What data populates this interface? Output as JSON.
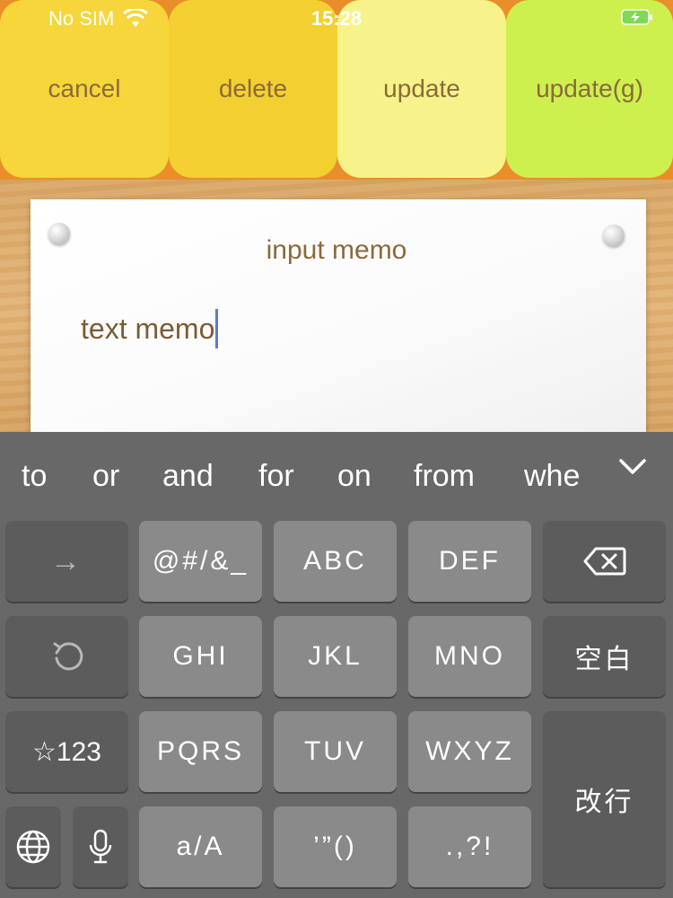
{
  "status_bar": {
    "carrier": "No SIM",
    "time": "15:28"
  },
  "toolbar": {
    "cancel_label": "cancel",
    "delete_label": "delete",
    "update_label": "update",
    "update_g_label": "update(g)",
    "colors": {
      "cancel": "#f6d63a",
      "delete": "#f4cf32",
      "update": "#f7f38a",
      "update_g": "#cdf04f"
    }
  },
  "memo": {
    "title": "input memo",
    "text": "text memo"
  },
  "keyboard": {
    "suggestions": [
      "to",
      "or",
      "and",
      "for",
      "on",
      "from",
      "whe"
    ],
    "keys": {
      "arrow": "→",
      "symbols": "@#/&_",
      "abc": "ABC",
      "def": "DEF",
      "ghi": "GHI",
      "jkl": "JKL",
      "mno": "MNO",
      "space": "空白",
      "num": "☆123",
      "pqrs": "PQRS",
      "tuv": "TUV",
      "wxyz": "WXYZ",
      "return": "改行",
      "case": "a/A",
      "quotes": "’”()",
      "punct": ".,?!"
    }
  }
}
